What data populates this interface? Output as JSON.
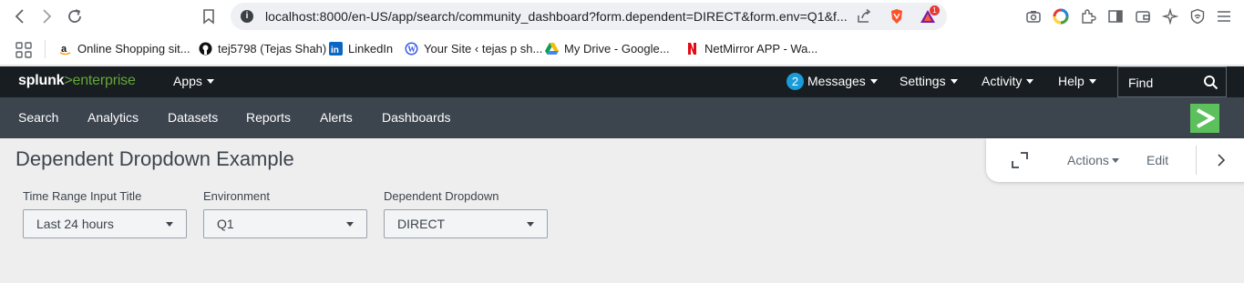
{
  "browser": {
    "url": "localhost:8000/en-US/app/search/community_dashboard?form.dependent=DIRECT&form.env=Q1&f...",
    "notification_count": "1",
    "bookmarks": [
      {
        "label": "Online Shopping sit...",
        "icon": "amazon-icon"
      },
      {
        "label": "tej5798 (Tejas Shah)",
        "icon": "github-icon"
      },
      {
        "label": "LinkedIn",
        "icon": "linkedin-icon"
      },
      {
        "label": "Your Site ‹ tejas p sh...",
        "icon": "wordpress-icon"
      },
      {
        "label": "My Drive - Google...",
        "icon": "google-drive-icon"
      },
      {
        "label": "NetMirror APP - Wa...",
        "icon": "netmirror-icon"
      }
    ]
  },
  "splunk": {
    "logo": {
      "brand": "splunk",
      "separator": ">",
      "product": "enterprise"
    },
    "top_menu": {
      "apps": "Apps",
      "messages_count": "2",
      "messages": "Messages",
      "settings": "Settings",
      "activity": "Activity",
      "help": "Help",
      "find": "Find"
    },
    "nav": [
      "Search",
      "Analytics",
      "Datasets",
      "Reports",
      "Alerts",
      "Dashboards"
    ],
    "colors": {
      "header": "#171d21",
      "nav": "#3c444d",
      "accent": "#5cc05c",
      "badge": "#1a9cd9"
    }
  },
  "dashboard": {
    "title": "Dependent Dropdown Example",
    "actions": {
      "actions_label": "Actions",
      "edit_label": "Edit"
    },
    "inputs": [
      {
        "label": "Time Range Input Title",
        "value": "Last 24 hours"
      },
      {
        "label": "Environment",
        "value": "Q1"
      },
      {
        "label": "Dependent Dropdown",
        "value": "DIRECT"
      }
    ]
  }
}
